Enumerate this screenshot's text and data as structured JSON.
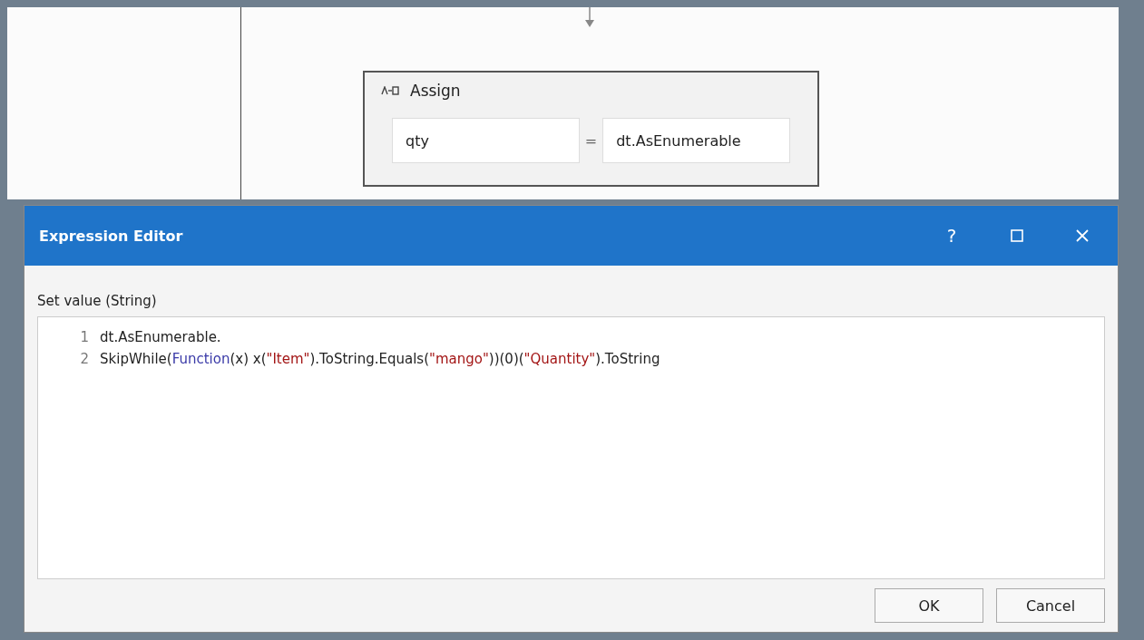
{
  "canvas": {
    "activity": {
      "title": "Assign",
      "to": "qty",
      "operator": "=",
      "value": "dt.AsEnumerable"
    }
  },
  "dialog": {
    "title": "Expression Editor",
    "help": "?",
    "label": "Set value (String)",
    "lines": [
      {
        "number": "1",
        "tokens": [
          {
            "kind": "plain",
            "text": "dt.AsEnumerable."
          }
        ]
      },
      {
        "number": "2",
        "tokens": [
          {
            "kind": "plain",
            "text": "SkipWhile("
          },
          {
            "kind": "keyword",
            "text": "Function"
          },
          {
            "kind": "plain",
            "text": "(x) x("
          },
          {
            "kind": "string",
            "text": "\"Item\""
          },
          {
            "kind": "plain",
            "text": ").ToString.Equals("
          },
          {
            "kind": "string",
            "text": "\"mango\""
          },
          {
            "kind": "plain",
            "text": "))(0)("
          },
          {
            "kind": "string",
            "text": "\"Quantity\""
          },
          {
            "kind": "plain",
            "text": ").ToString"
          }
        ]
      }
    ],
    "buttons": [
      "OK",
      "Cancel"
    ]
  }
}
